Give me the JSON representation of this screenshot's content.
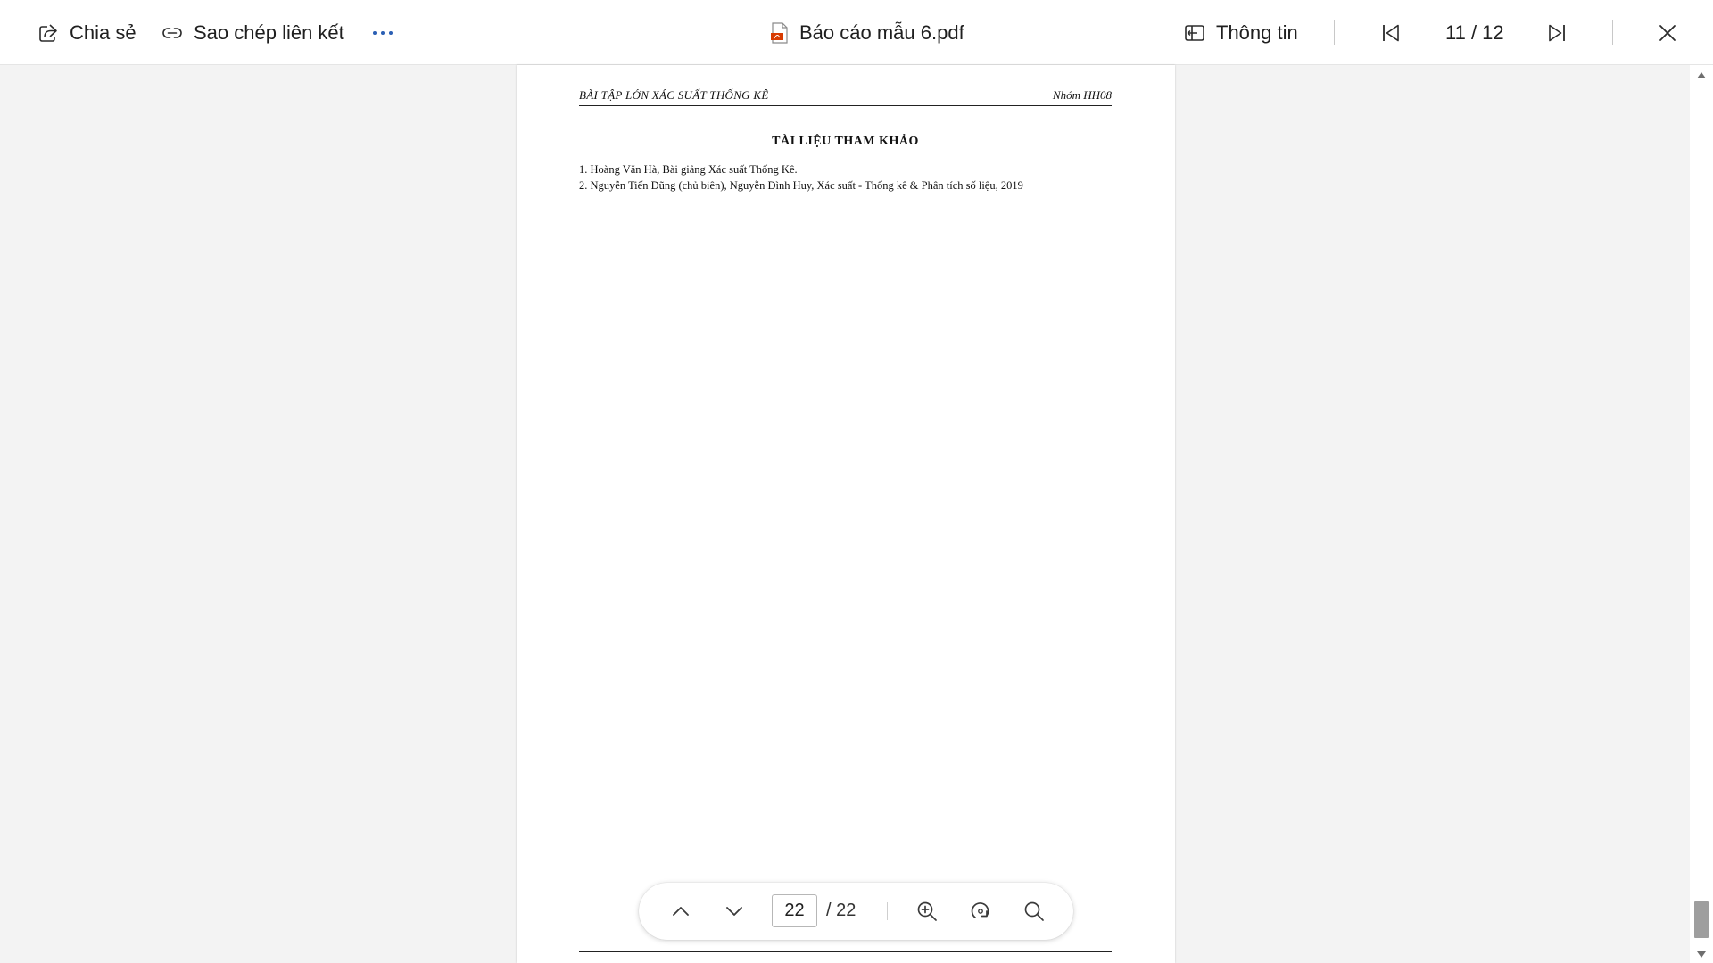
{
  "toolbar": {
    "share_label": "Chia sẻ",
    "copy_link_label": "Sao chép liên kết",
    "more_icon": "more-dots-icon",
    "file_name": "Báo cáo mẫu 6.pdf",
    "info_label": "Thông tin",
    "item_counter": "11 / 12"
  },
  "document": {
    "running_header_left": "BÀI TẬP LỚN XÁC SUẤT THỐNG KÊ",
    "running_header_right": "Nhóm HH08",
    "section_title": "TÀI LIỆU THAM KHẢO",
    "references": [
      "1. Hoàng Văn Hà, Bài giảng Xác suất Thống Kê.",
      "2. Nguyễn Tiến Dũng (chủ biên), Nguyễn Đình Huy, Xác suất - Thống kê & Phân tích số liệu, 2019"
    ]
  },
  "page_nav": {
    "current_page": "22",
    "total_pages": "/ 22"
  },
  "colors": {
    "accent": "#2b5fb4",
    "pdf_icon": "#d83b01",
    "background": "#f3f3f3",
    "scroll_thumb": "#9e9e9e"
  }
}
